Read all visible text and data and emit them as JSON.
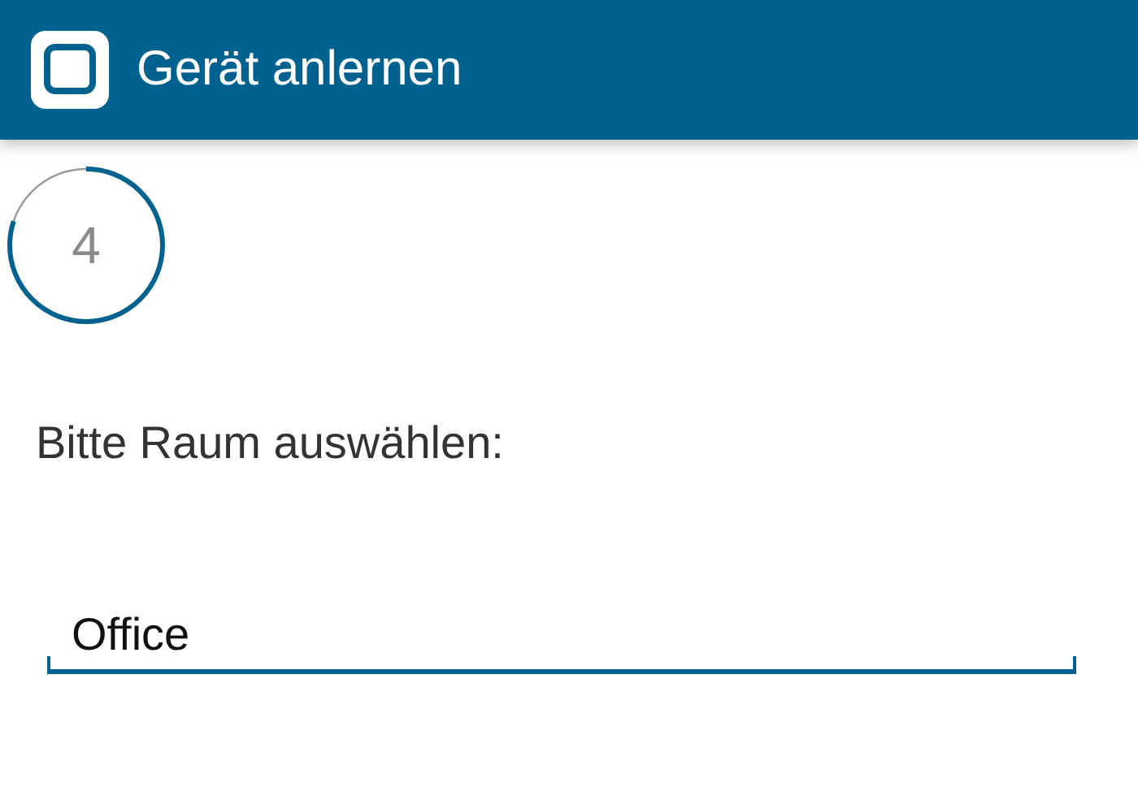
{
  "app_bar": {
    "title": "Gerät anlernen"
  },
  "step": {
    "number": "4",
    "level": 0.8
  },
  "prompt": "Bitte Raum auswählen:",
  "room_field": {
    "value": "Office"
  }
}
